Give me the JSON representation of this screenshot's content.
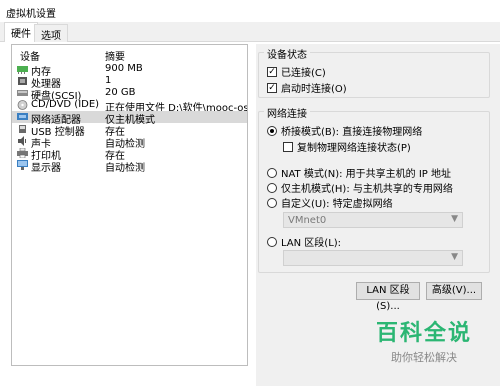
{
  "window": {
    "title": "虚拟机设置"
  },
  "tabs": [
    {
      "label": "硬件"
    },
    {
      "label": "选项"
    }
  ],
  "device_list": {
    "header": {
      "device": "设备",
      "summary": "摘要"
    },
    "rows": [
      {
        "name": "内存",
        "value": "900 MB",
        "icon": "memory-icon"
      },
      {
        "name": "处理器",
        "value": "1",
        "icon": "processor-icon"
      },
      {
        "name": "硬盘(SCSI)",
        "value": "20 GB",
        "icon": "hard-disk-icon"
      },
      {
        "name": "CD/DVD (IDE)",
        "value": "正在使用文件 D:\\软件\\mooc-os-2...",
        "icon": "cd-dvd-icon"
      },
      {
        "name": "网络适配器",
        "value": "仅主机模式",
        "icon": "network-adapter-icon"
      },
      {
        "name": "USB 控制器",
        "value": "存在",
        "icon": "usb-controller-icon"
      },
      {
        "name": "声卡",
        "value": "自动检测",
        "icon": "sound-card-icon"
      },
      {
        "name": "打印机",
        "value": "存在",
        "icon": "printer-icon"
      },
      {
        "name": "显示器",
        "value": "自动检测",
        "icon": "display-icon"
      }
    ],
    "selected_index": 4
  },
  "device_status": {
    "title": "设备状态",
    "connected_label": "已连接(C)",
    "connected": true,
    "connect_at_power_on_label": "启动时连接(O)",
    "connect_at_power_on": true
  },
  "network_connection": {
    "title": "网络连接",
    "bridged_label": "桥接模式(B): 直接连接物理网络",
    "replicate_label": "复制物理网络连接状态(P)",
    "nat_label": "NAT 模式(N): 用于共享主机的 IP 地址",
    "hostonly_label": "仅主机模式(H): 与主机共享的专用网络",
    "custom_label": "自定义(U): 特定虚拟网络",
    "custom_select_value": "VMnet0",
    "lan_label": "LAN 区段(L):",
    "lan_select_value": "",
    "selected": "bridged"
  },
  "buttons": {
    "lan_segments": "LAN 区段(S)...",
    "advanced": "高级(V)..."
  },
  "watermark": {
    "main": "百科全说",
    "sub": "助你轻松解决"
  }
}
